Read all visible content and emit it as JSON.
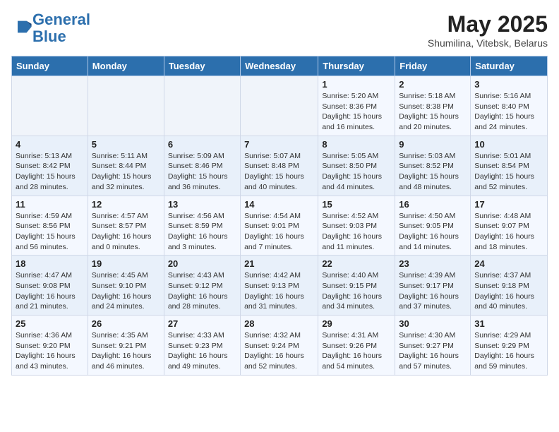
{
  "header": {
    "logo_line1": "General",
    "logo_line2": "Blue",
    "month": "May 2025",
    "location": "Shumilina, Vitebsk, Belarus"
  },
  "weekdays": [
    "Sunday",
    "Monday",
    "Tuesday",
    "Wednesday",
    "Thursday",
    "Friday",
    "Saturday"
  ],
  "weeks": [
    [
      {
        "day": "",
        "info": ""
      },
      {
        "day": "",
        "info": ""
      },
      {
        "day": "",
        "info": ""
      },
      {
        "day": "",
        "info": ""
      },
      {
        "day": "1",
        "info": "Sunrise: 5:20 AM\nSunset: 8:36 PM\nDaylight: 15 hours\nand 16 minutes."
      },
      {
        "day": "2",
        "info": "Sunrise: 5:18 AM\nSunset: 8:38 PM\nDaylight: 15 hours\nand 20 minutes."
      },
      {
        "day": "3",
        "info": "Sunrise: 5:16 AM\nSunset: 8:40 PM\nDaylight: 15 hours\nand 24 minutes."
      }
    ],
    [
      {
        "day": "4",
        "info": "Sunrise: 5:13 AM\nSunset: 8:42 PM\nDaylight: 15 hours\nand 28 minutes."
      },
      {
        "day": "5",
        "info": "Sunrise: 5:11 AM\nSunset: 8:44 PM\nDaylight: 15 hours\nand 32 minutes."
      },
      {
        "day": "6",
        "info": "Sunrise: 5:09 AM\nSunset: 8:46 PM\nDaylight: 15 hours\nand 36 minutes."
      },
      {
        "day": "7",
        "info": "Sunrise: 5:07 AM\nSunset: 8:48 PM\nDaylight: 15 hours\nand 40 minutes."
      },
      {
        "day": "8",
        "info": "Sunrise: 5:05 AM\nSunset: 8:50 PM\nDaylight: 15 hours\nand 44 minutes."
      },
      {
        "day": "9",
        "info": "Sunrise: 5:03 AM\nSunset: 8:52 PM\nDaylight: 15 hours\nand 48 minutes."
      },
      {
        "day": "10",
        "info": "Sunrise: 5:01 AM\nSunset: 8:54 PM\nDaylight: 15 hours\nand 52 minutes."
      }
    ],
    [
      {
        "day": "11",
        "info": "Sunrise: 4:59 AM\nSunset: 8:56 PM\nDaylight: 15 hours\nand 56 minutes."
      },
      {
        "day": "12",
        "info": "Sunrise: 4:57 AM\nSunset: 8:57 PM\nDaylight: 16 hours\nand 0 minutes."
      },
      {
        "day": "13",
        "info": "Sunrise: 4:56 AM\nSunset: 8:59 PM\nDaylight: 16 hours\nand 3 minutes."
      },
      {
        "day": "14",
        "info": "Sunrise: 4:54 AM\nSunset: 9:01 PM\nDaylight: 16 hours\nand 7 minutes."
      },
      {
        "day": "15",
        "info": "Sunrise: 4:52 AM\nSunset: 9:03 PM\nDaylight: 16 hours\nand 11 minutes."
      },
      {
        "day": "16",
        "info": "Sunrise: 4:50 AM\nSunset: 9:05 PM\nDaylight: 16 hours\nand 14 minutes."
      },
      {
        "day": "17",
        "info": "Sunrise: 4:48 AM\nSunset: 9:07 PM\nDaylight: 16 hours\nand 18 minutes."
      }
    ],
    [
      {
        "day": "18",
        "info": "Sunrise: 4:47 AM\nSunset: 9:08 PM\nDaylight: 16 hours\nand 21 minutes."
      },
      {
        "day": "19",
        "info": "Sunrise: 4:45 AM\nSunset: 9:10 PM\nDaylight: 16 hours\nand 24 minutes."
      },
      {
        "day": "20",
        "info": "Sunrise: 4:43 AM\nSunset: 9:12 PM\nDaylight: 16 hours\nand 28 minutes."
      },
      {
        "day": "21",
        "info": "Sunrise: 4:42 AM\nSunset: 9:13 PM\nDaylight: 16 hours\nand 31 minutes."
      },
      {
        "day": "22",
        "info": "Sunrise: 4:40 AM\nSunset: 9:15 PM\nDaylight: 16 hours\nand 34 minutes."
      },
      {
        "day": "23",
        "info": "Sunrise: 4:39 AM\nSunset: 9:17 PM\nDaylight: 16 hours\nand 37 minutes."
      },
      {
        "day": "24",
        "info": "Sunrise: 4:37 AM\nSunset: 9:18 PM\nDaylight: 16 hours\nand 40 minutes."
      }
    ],
    [
      {
        "day": "25",
        "info": "Sunrise: 4:36 AM\nSunset: 9:20 PM\nDaylight: 16 hours\nand 43 minutes."
      },
      {
        "day": "26",
        "info": "Sunrise: 4:35 AM\nSunset: 9:21 PM\nDaylight: 16 hours\nand 46 minutes."
      },
      {
        "day": "27",
        "info": "Sunrise: 4:33 AM\nSunset: 9:23 PM\nDaylight: 16 hours\nand 49 minutes."
      },
      {
        "day": "28",
        "info": "Sunrise: 4:32 AM\nSunset: 9:24 PM\nDaylight: 16 hours\nand 52 minutes."
      },
      {
        "day": "29",
        "info": "Sunrise: 4:31 AM\nSunset: 9:26 PM\nDaylight: 16 hours\nand 54 minutes."
      },
      {
        "day": "30",
        "info": "Sunrise: 4:30 AM\nSunset: 9:27 PM\nDaylight: 16 hours\nand 57 minutes."
      },
      {
        "day": "31",
        "info": "Sunrise: 4:29 AM\nSunset: 9:29 PM\nDaylight: 16 hours\nand 59 minutes."
      }
    ]
  ]
}
